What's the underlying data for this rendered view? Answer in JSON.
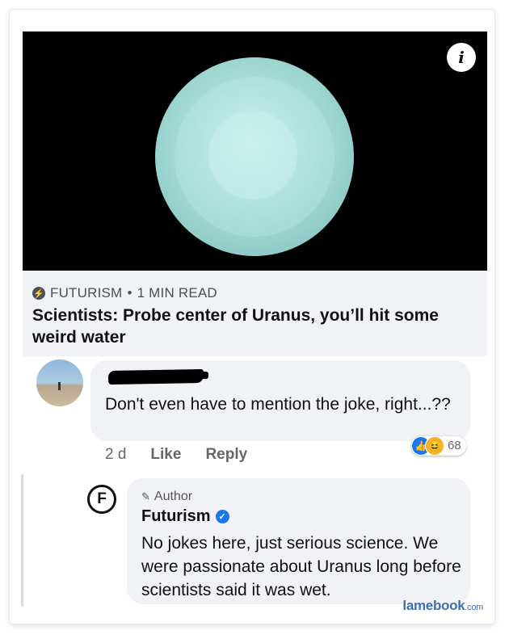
{
  "article": {
    "source": "FUTURISM",
    "separator": "•",
    "read_time": "1 MIN READ",
    "headline": "Scientists: Probe center of Uranus, you’ll hit some weird water",
    "info_glyph": "i"
  },
  "comment": {
    "text": "Don't even have to mention the joke, right...??",
    "time": "2 d",
    "like_label": "Like",
    "reply_label": "Reply",
    "reaction_count": "68",
    "reaction_icons": [
      "like-icon",
      "haha-icon"
    ]
  },
  "reply": {
    "avatar_letter": "F",
    "author_tag": "Author",
    "author_name": "Futurism",
    "text": "No jokes here, just serious science. We were passionate about Uranus long before scientists said it was wet."
  },
  "watermark": {
    "name": "lamebook",
    "tld": ".com"
  },
  "colors": {
    "planet": "#a5dbd6",
    "link_bg": "#f0f2f5",
    "facebook_blue": "#1877f2",
    "haha_yellow": "#f7b125",
    "watermark": "#3b6fb6"
  }
}
